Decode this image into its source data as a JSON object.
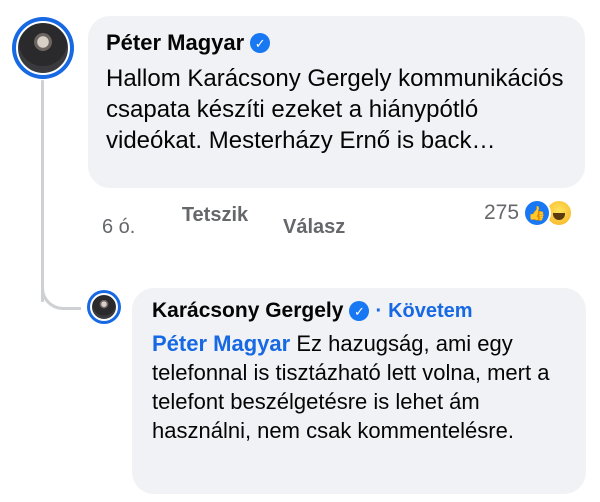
{
  "comment": {
    "author": "Péter Magyar",
    "text": "Hallom Karácsony Gergely kommunikációs csapata készíti ezeket a hiánypótló videókat. Mesterházy Ernő is back…",
    "time": "6 ó.",
    "like_label": "Tetszik",
    "reply_label": "Válasz",
    "reaction_count": "275",
    "reaction_icons": [
      "like-icon",
      "haha-icon"
    ]
  },
  "reply": {
    "author": "Karácsony Gergely",
    "follow_separator": "·",
    "follow_label": "Követem",
    "mention": "Péter Magyar",
    "text": "Ez hazugság, ami egy telefonnal is tisztázható lett volna, mert a telefont beszélgetésre is lehet ám használni, nem csak kommentelésre."
  },
  "colors": {
    "accent": "#1668e3",
    "bubble": "#f0f2f5",
    "meta": "#65676b"
  }
}
